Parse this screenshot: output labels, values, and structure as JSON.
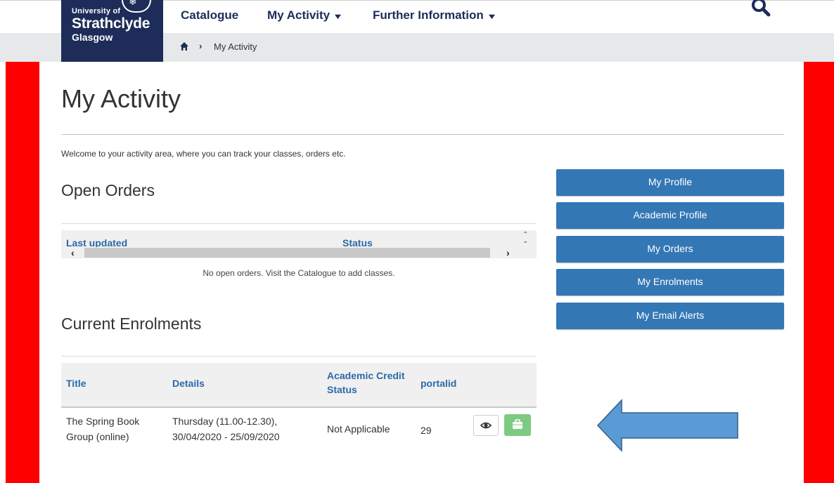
{
  "logo": {
    "line1": "University of",
    "line2": "Strathclyde",
    "line3": "Glasgow"
  },
  "nav": {
    "items": [
      {
        "label": "Catalogue"
      },
      {
        "label": "My Activity"
      },
      {
        "label": "Further Information"
      }
    ],
    "search_icon": "search-icon"
  },
  "breadcrumb": {
    "home_icon": "home-icon",
    "current": "My Activity"
  },
  "page": {
    "title": "My Activity",
    "welcome": "Welcome to your activity area, where you can track your classes, orders etc."
  },
  "open_orders": {
    "heading": "Open Orders",
    "columns": [
      "Last updated",
      "Status"
    ],
    "empty_message": "No open orders. Visit the Catalogue to add classes."
  },
  "enrolments": {
    "heading": "Current Enrolments",
    "columns": {
      "title": "Title",
      "details": "Details",
      "credit_line1": "Academic Credit",
      "credit_line2": "Status",
      "portalid": "portalid"
    },
    "rows": [
      {
        "title_line1": "The Spring Book",
        "title_line2": "Group (online)",
        "details_line1": "Thursday (11.00-12.30),",
        "details_line2": "30/04/2020 - 25/09/2020",
        "credit_status": "Not Applicable",
        "portalid": "29",
        "view_icon": "eye-icon",
        "action_icon": "briefcase-icon"
      }
    ]
  },
  "sidebar": {
    "buttons": [
      {
        "label": "My Profile"
      },
      {
        "label": "Academic Profile"
      },
      {
        "label": "My Orders"
      },
      {
        "label": "My Enrolments"
      },
      {
        "label": "My Email Alerts"
      }
    ]
  },
  "colors": {
    "brand_navy": "#1d2c59",
    "button_blue": "#3477b5",
    "link_blue": "#2a6aa8",
    "side_red": "#ff0000",
    "green_action": "#7dcb83",
    "arrow_fill": "#5b9bd5"
  }
}
